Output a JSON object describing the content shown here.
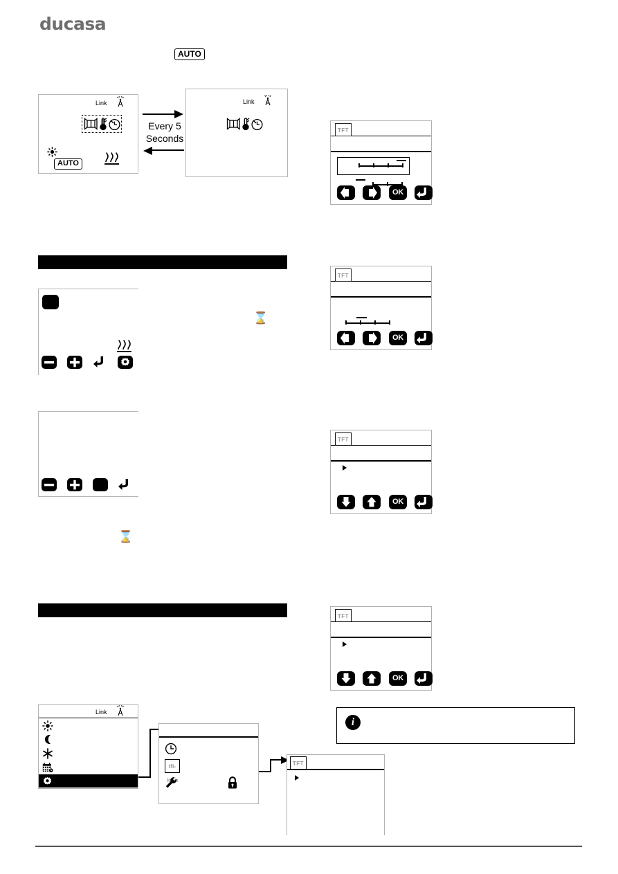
{
  "brand": {
    "name": "ducasa"
  },
  "top_badge": {
    "label": "AUTO"
  },
  "flow_diagram": {
    "caption_line1": "Every 5",
    "caption_line2": "Seconds",
    "screen_left": {
      "link_label": "Link",
      "link_icon": "antenna-icon",
      "status_icons": [
        "sun-icon",
        "heat-waves-icon"
      ],
      "mode_badge": "AUTO",
      "highlighted_icons": [
        "radiator-icon",
        "thermometer-icon",
        "clock-icon"
      ]
    },
    "screen_right": {
      "link_label": "Link",
      "link_icon": "antenna-icon",
      "icons": [
        "radiator-icon",
        "thermometer-icon",
        "clock-icon"
      ]
    }
  },
  "section_bars": [
    {
      "id": "section-bar-1",
      "label": ""
    },
    {
      "id": "section-bar-2",
      "label": ""
    }
  ],
  "lcd_panel_1": {
    "buttons": [
      {
        "name": "minus-button",
        "icon": "minus-icon"
      },
      {
        "name": "plus-button",
        "icon": "plus-icon"
      },
      {
        "name": "back-button",
        "icon": "back-arrow-icon"
      },
      {
        "name": "gear-button",
        "icon": "gear-icon"
      }
    ],
    "heat_icon": "heat-waves-icon",
    "selection_marker": "solid-square-icon"
  },
  "lcd_panel_2": {
    "buttons": [
      {
        "name": "minus-button",
        "icon": "minus-icon"
      },
      {
        "name": "plus-button",
        "icon": "plus-icon"
      },
      {
        "name": "square-button",
        "icon": "solid-square-icon"
      },
      {
        "name": "back-button",
        "icon": "back-arrow-icon"
      }
    ]
  },
  "hourglass_icons": [
    {
      "name": "hourglass-icon-1",
      "glyph": "⌛"
    },
    {
      "name": "hourglass-icon-2",
      "glyph": "⌛"
    }
  ],
  "tft_panels": [
    {
      "id": "tft-panel-1",
      "logo": "TFT",
      "ok_label": "OK",
      "buttons": [
        {
          "name": "left-arrow-button",
          "icon": "left-arrow-icon",
          "label": ""
        },
        {
          "name": "right-arrow-button",
          "icon": "right-arrow-icon",
          "label": ""
        },
        {
          "name": "ok-button",
          "icon": "ok-icon",
          "label": "OK"
        },
        {
          "name": "back-button",
          "icon": "back-arrow-icon",
          "label": ""
        }
      ],
      "content": "slider-boxed"
    },
    {
      "id": "tft-panel-2",
      "logo": "TFT",
      "ok_label": "OK",
      "buttons": [
        {
          "name": "left-arrow-button",
          "icon": "left-arrow-icon",
          "label": ""
        },
        {
          "name": "right-arrow-button",
          "icon": "right-arrow-icon",
          "label": ""
        },
        {
          "name": "ok-button",
          "icon": "ok-icon",
          "label": "OK"
        },
        {
          "name": "back-button",
          "icon": "back-arrow-icon",
          "label": ""
        }
      ],
      "content": "slider-plain"
    },
    {
      "id": "tft-panel-3",
      "logo": "TFT",
      "ok_label": "OK",
      "buttons": [
        {
          "name": "down-arrow-button",
          "icon": "down-arrow-icon",
          "label": ""
        },
        {
          "name": "up-arrow-button",
          "icon": "up-arrow-icon",
          "label": ""
        },
        {
          "name": "ok-button",
          "icon": "ok-icon",
          "label": "OK"
        },
        {
          "name": "back-button",
          "icon": "back-arrow-icon",
          "label": ""
        }
      ],
      "content": "list-pointer"
    },
    {
      "id": "tft-panel-4",
      "logo": "TFT",
      "ok_label": "OK",
      "buttons": [
        {
          "name": "down-arrow-button",
          "icon": "down-arrow-icon",
          "label": ""
        },
        {
          "name": "up-arrow-button",
          "icon": "up-arrow-icon",
          "label": ""
        },
        {
          "name": "ok-button",
          "icon": "ok-icon",
          "label": "OK"
        },
        {
          "name": "back-button",
          "icon": "back-arrow-icon",
          "label": ""
        }
      ],
      "content": "list-pointer"
    }
  ],
  "menu_screen": {
    "link_label": "Link",
    "items": [
      {
        "name": "menu-item-comfort",
        "icon": "sun-icon",
        "selected": false
      },
      {
        "name": "menu-item-eco",
        "icon": "moon-icon",
        "selected": false
      },
      {
        "name": "menu-item-antifreeze",
        "icon": "snowflake-icon",
        "selected": false
      },
      {
        "name": "menu-item-program",
        "icon": "calendar-clock-icon",
        "selected": false
      },
      {
        "name": "menu-item-settings",
        "icon": "gear-icon",
        "selected": true
      }
    ]
  },
  "settings_screen": {
    "items": [
      {
        "name": "settings-item-clock",
        "icon": "clock-icon"
      },
      {
        "name": "settings-item-tft",
        "icon": "tft-icon"
      },
      {
        "name": "settings-item-service",
        "icon": "wrench-icon"
      }
    ],
    "lock_icon": "lock-icon"
  },
  "detail_screen": {
    "logo": "TFT",
    "pointer": "triangle-pointer-icon"
  },
  "info_note": {
    "icon": "info-icon",
    "text": ""
  }
}
